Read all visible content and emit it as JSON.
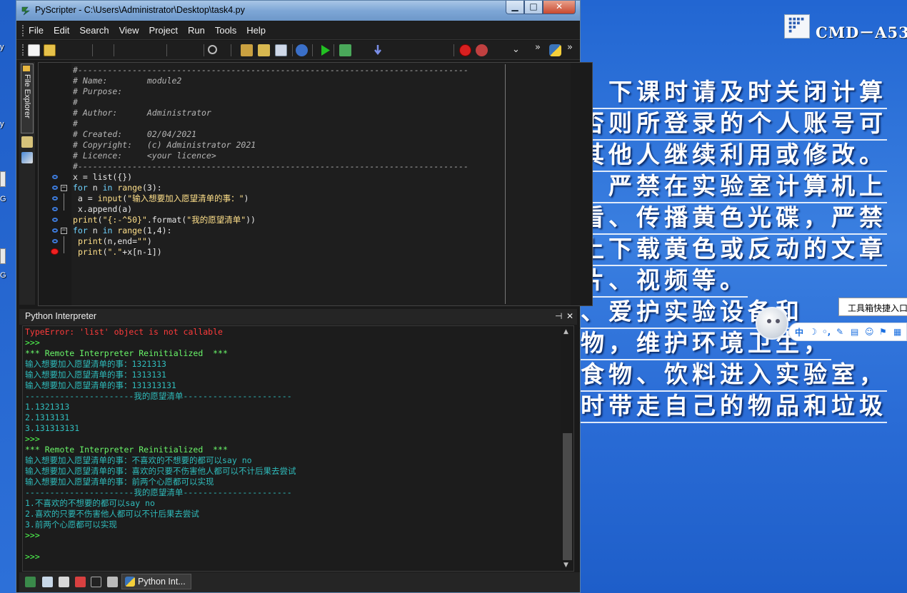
{
  "window": {
    "title": "PyScripter - C:\\Users\\Administrator\\Desktop\\task4.py",
    "controls": {
      "minimize": "▁",
      "maximize": "□",
      "close": "✕"
    }
  },
  "menu": [
    "File",
    "Edit",
    "Search",
    "View",
    "Project",
    "Run",
    "Tools",
    "Help"
  ],
  "toolbar": {
    "icons": [
      "new-file-icon",
      "open-file-icon",
      "find-icon",
      "debug-icon",
      "step-icon",
      "watch-icon",
      "info-icon",
      "run-icon",
      "debug-run-icon",
      "step-into-icon",
      "breakpoint-icon",
      "clear-breakpoints-icon",
      "python-icon"
    ],
    "overflow": "»"
  },
  "side_dock": {
    "file_explorer_tab": "File Explorer"
  },
  "editor": {
    "lines": [
      {
        "t": "cm",
        "text": "#-------------------------------------------------------------------------------"
      },
      {
        "t": "cm",
        "text": "# Name:        module2"
      },
      {
        "t": "cm",
        "text": "# Purpose:"
      },
      {
        "t": "cm",
        "text": "#"
      },
      {
        "t": "cm",
        "text": "# Author:      Administrator"
      },
      {
        "t": "cm",
        "text": "#"
      },
      {
        "t": "cm",
        "text": "# Created:     02/04/2021"
      },
      {
        "t": "cm",
        "text": "# Copyright:   (c) Administrator 2021"
      },
      {
        "t": "cm",
        "text": "# Licence:     <your licence>"
      },
      {
        "t": "cm",
        "text": "#-------------------------------------------------------------------------------"
      },
      {
        "t": "code",
        "text": "x = list({})"
      },
      {
        "t": "code",
        "text": "for n in range(3):"
      },
      {
        "t": "code",
        "text": " a = input(\"输入想要加入愿望清单的事：\")"
      },
      {
        "t": "code",
        "text": " x.append(a)"
      },
      {
        "t": "code",
        "text": "print(\"{:-^50}\".format(\"我的愿望清单\"))"
      },
      {
        "t": "code",
        "text": "for n in range(1,4):"
      },
      {
        "t": "code",
        "text": " print(n,end=\"\")"
      },
      {
        "t": "code",
        "text": " print(\".\"+x[n-1])"
      }
    ]
  },
  "interpreter": {
    "title": "Python Interpreter",
    "pin": "⊣",
    "close": "✕",
    "lines": [
      {
        "c": "c-err",
        "text": "TypeError: 'list' object is not callable"
      },
      {
        "c": "c-prompt",
        "text": ">>>"
      },
      {
        "c": "c-green",
        "text": "*** Remote Interpreter Reinitialized  ***"
      },
      {
        "c": "c-teal",
        "text": "输入想要加入愿望清单的事：1321313"
      },
      {
        "c": "c-teal",
        "text": "输入想要加入愿望清单的事：1313131"
      },
      {
        "c": "c-teal",
        "text": "输入想要加入愿望清单的事：131313131"
      },
      {
        "c": "c-teal",
        "text": "----------------------我的愿望清单----------------------"
      },
      {
        "c": "c-teal",
        "text": "1.1321313"
      },
      {
        "c": "c-teal",
        "text": "2.1313131"
      },
      {
        "c": "c-teal",
        "text": "3.131313131"
      },
      {
        "c": "c-prompt",
        "text": ">>>"
      },
      {
        "c": "c-green",
        "text": "*** Remote Interpreter Reinitialized  ***"
      },
      {
        "c": "c-teal",
        "text": "输入想要加入愿望清单的事：不喜欢的不想要的都可以say no"
      },
      {
        "c": "c-teal",
        "text": "输入想要加入愿望清单的事：喜欢的只要不伤害他人都可以不计后果去尝试"
      },
      {
        "c": "c-teal",
        "text": "输入想要加入愿望清单的事：前两个心愿都可以实现"
      },
      {
        "c": "c-teal",
        "text": "----------------------我的愿望清单----------------------"
      },
      {
        "c": "c-teal",
        "text": "1.不喜欢的不想要的都可以say no"
      },
      {
        "c": "c-teal",
        "text": "2.喜欢的只要不伤害他人都可以不计后果去尝试"
      },
      {
        "c": "c-teal",
        "text": "3.前两个心愿都可以实现"
      },
      {
        "c": "c-prompt",
        "text": ">>>"
      },
      {
        "c": "c-prompt",
        "text": ""
      },
      {
        "c": "c-prompt",
        "text": ">>>"
      }
    ]
  },
  "bottom_tabs": {
    "active_label": "Python Int..."
  },
  "desktop": {
    "brand": "CMD－A53",
    "rules": [
      "、下课时请及时关闭计算",
      "否则所登录的个人账号可",
      "其他人继续利用或修改。",
      "、严禁在实验室计算机上",
      "看、传播黄色光碟，严禁",
      "上下载黄色或反动的文章",
      "片、视频等。",
      "、爱护实验设备和",
      "物，维护环境卫生，",
      "食物、饮料进入实验室，",
      "时带走自己的物品和垃圾"
    ],
    "toolbox_tip": "工具箱快捷入口",
    "toolbox_items": [
      "中",
      "☽",
      "◦,",
      "✎",
      "▤",
      "☺",
      "⚑",
      "▦"
    ],
    "left_icon_labels": [
      "y",
      "y",
      "G",
      "G"
    ]
  },
  "colors": {
    "accent_blue": "#1f63d0",
    "error": "#ff3b3b",
    "prompt": "#50ff50",
    "output": "#2fbcbc"
  }
}
